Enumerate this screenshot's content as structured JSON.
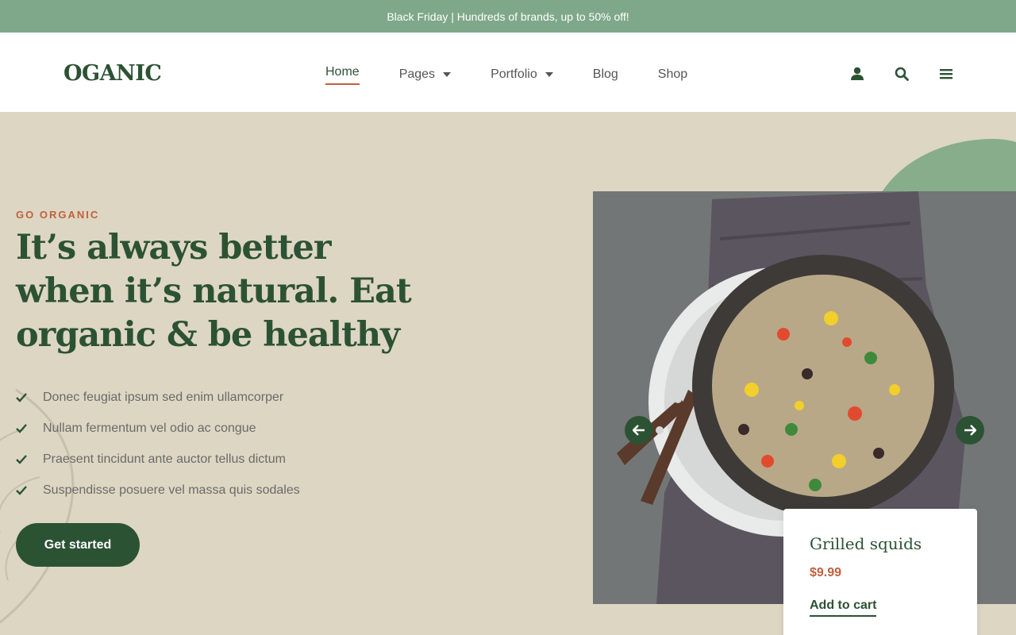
{
  "announcement": "Black Friday | Hundreds of brands, up to 50% off!",
  "brand": {
    "logo_text": "OGANIC"
  },
  "nav": {
    "items": [
      {
        "label": "Home",
        "active": true,
        "dropdown": false
      },
      {
        "label": "Pages",
        "active": false,
        "dropdown": true
      },
      {
        "label": "Portfolio",
        "active": false,
        "dropdown": true
      },
      {
        "label": "Blog",
        "active": false,
        "dropdown": false
      },
      {
        "label": "Shop",
        "active": false,
        "dropdown": false
      }
    ]
  },
  "header_icons": [
    "user-icon",
    "search-icon",
    "menu-icon"
  ],
  "hero": {
    "eyebrow": "GO ORGANIC",
    "headline": "It’s always better when it’s natural. Eat organic & be healthy",
    "features": [
      "Donec feugiat ipsum sed enim ullamcorper",
      "Nullam fermentum vel odio ac congue",
      "Praesent tincidunt ante auctor tellus dictum",
      "Suspendisse posuere vel massa quis sodales"
    ],
    "cta_label": "Get started"
  },
  "slider": {
    "prev_icon": "arrow-left-icon",
    "next_icon": "arrow-right-icon"
  },
  "product": {
    "name": "Grilled squids",
    "price": "$9.99",
    "add_to_cart": "Add to cart"
  },
  "colors": {
    "primary_green": "#2c5234",
    "accent": "#c0603d",
    "topbar": "#7fa88a",
    "hero_bg": "#ddd6c3"
  }
}
